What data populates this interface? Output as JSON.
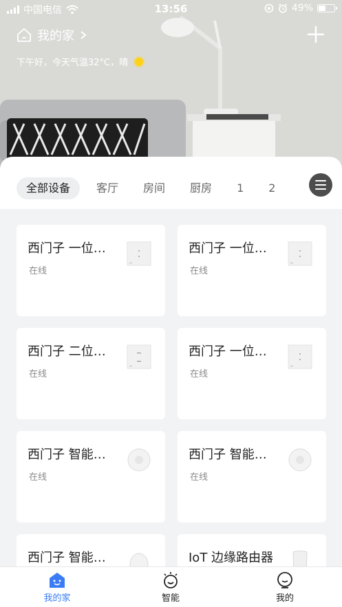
{
  "status_bar": {
    "carrier": "中国电信",
    "time": "13:56",
    "battery": "49%",
    "battery_level": 0.49
  },
  "header": {
    "home_name": "我的家",
    "greeting": "下午好，今天气温32°C，晴"
  },
  "tabs": [
    {
      "label": "全部设备",
      "active": true
    },
    {
      "label": "客厅"
    },
    {
      "label": "房间"
    },
    {
      "label": "厨房"
    },
    {
      "label": "1"
    },
    {
      "label": "2"
    }
  ],
  "devices": [
    {
      "name": "西门子 一位…",
      "status": "在线",
      "icon": "single-switch-icon"
    },
    {
      "name": "西门子 一位…",
      "status": "在线",
      "icon": "single-switch-icon"
    },
    {
      "name": "西门子 二位…",
      "status": "在线",
      "icon": "double-switch-icon"
    },
    {
      "name": "西门子 一位…",
      "status": "在线",
      "icon": "single-switch-icon"
    },
    {
      "name": "西门子 智能…",
      "status": "在线",
      "icon": "round-sensor-icon"
    },
    {
      "name": "西门子 智能…",
      "status": "在线",
      "icon": "round-sensor-icon"
    },
    {
      "name": "西门子 智能…",
      "status": "",
      "icon": "oval-sensor-icon"
    },
    {
      "name": "IoT 边缘路由器",
      "status": "",
      "icon": "router-icon"
    }
  ],
  "bottom_nav": [
    {
      "label": "我的家",
      "active": true,
      "icon": "home-face-icon"
    },
    {
      "label": "智能",
      "icon": "smart-face-icon"
    },
    {
      "label": "我的",
      "icon": "profile-face-icon"
    }
  ],
  "colors": {
    "accent": "#3a7cf5",
    "sun": "#ffd21a",
    "background": "#f2f3f5"
  }
}
